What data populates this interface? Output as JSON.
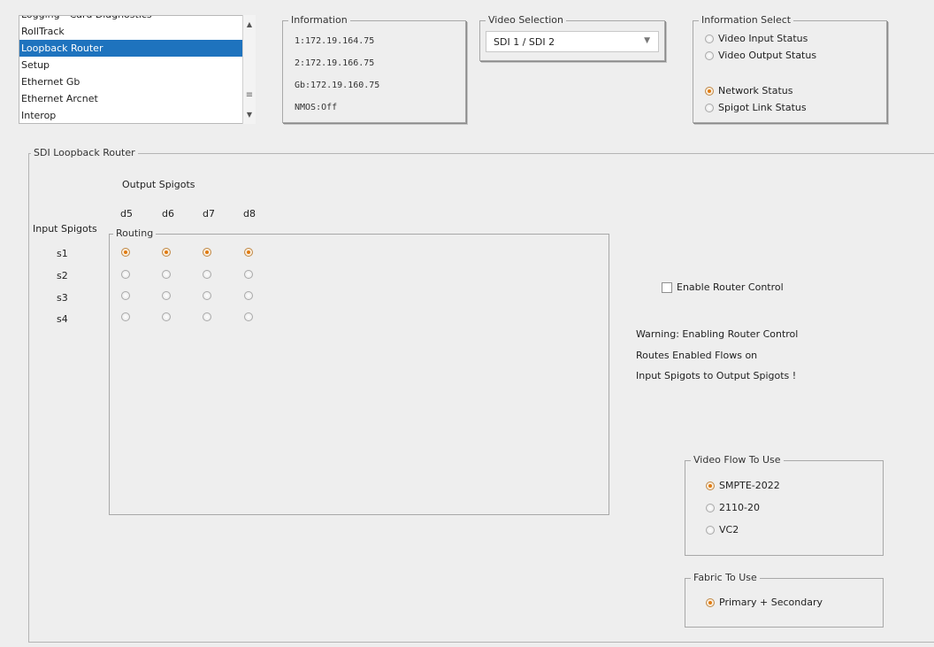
{
  "nav_list": {
    "items": [
      {
        "label": "Logging - Card Diagnostics",
        "selected": false
      },
      {
        "label": "RollTrack",
        "selected": false
      },
      {
        "label": "Loopback Router",
        "selected": true
      },
      {
        "label": "Setup",
        "selected": false
      },
      {
        "label": "Ethernet Gb",
        "selected": false
      },
      {
        "label": "Ethernet Arcnet",
        "selected": false
      },
      {
        "label": "Interop",
        "selected": false
      }
    ]
  },
  "information": {
    "title": "Information",
    "lines": [
      "1:172.19.164.75",
      "2:172.19.166.75",
      "Gb:172.19.160.75",
      "NMOS:Off"
    ]
  },
  "video_selection": {
    "title": "Video Selection",
    "value": "SDI 1 / SDI 2"
  },
  "information_select": {
    "title": "Information Select",
    "options": [
      {
        "label": "Video Input Status",
        "selected": false
      },
      {
        "label": "Video Output Status",
        "selected": false
      },
      {
        "label": "Network Status",
        "selected": true
      },
      {
        "label": "Spigot Link Status",
        "selected": false
      }
    ]
  },
  "router": {
    "title": "SDI Loopback Router",
    "output_spigots_label": "Output Spigots",
    "input_spigots_label": "Input Spigots",
    "routing_label": "Routing",
    "outputs": [
      "d5",
      "d6",
      "d7",
      "d8"
    ],
    "inputs": [
      "s1",
      "s2",
      "s3",
      "s4"
    ],
    "routing_selected_input": "s1"
  },
  "enable_router": {
    "label": "Enable Router Control",
    "checked": false
  },
  "warning": {
    "lines": [
      "Warning: Enabling Router Control",
      "Routes Enabled Flows on",
      "Input Spigots to Output Spigots !"
    ]
  },
  "video_flow": {
    "title": "Video Flow To Use",
    "options": [
      {
        "label": "SMPTE-2022",
        "selected": true
      },
      {
        "label": "2110-20",
        "selected": false
      },
      {
        "label": "VC2",
        "selected": false
      }
    ]
  },
  "fabric": {
    "title": "Fabric To Use",
    "options": [
      {
        "label": "Primary + Secondary",
        "selected": true
      }
    ]
  }
}
